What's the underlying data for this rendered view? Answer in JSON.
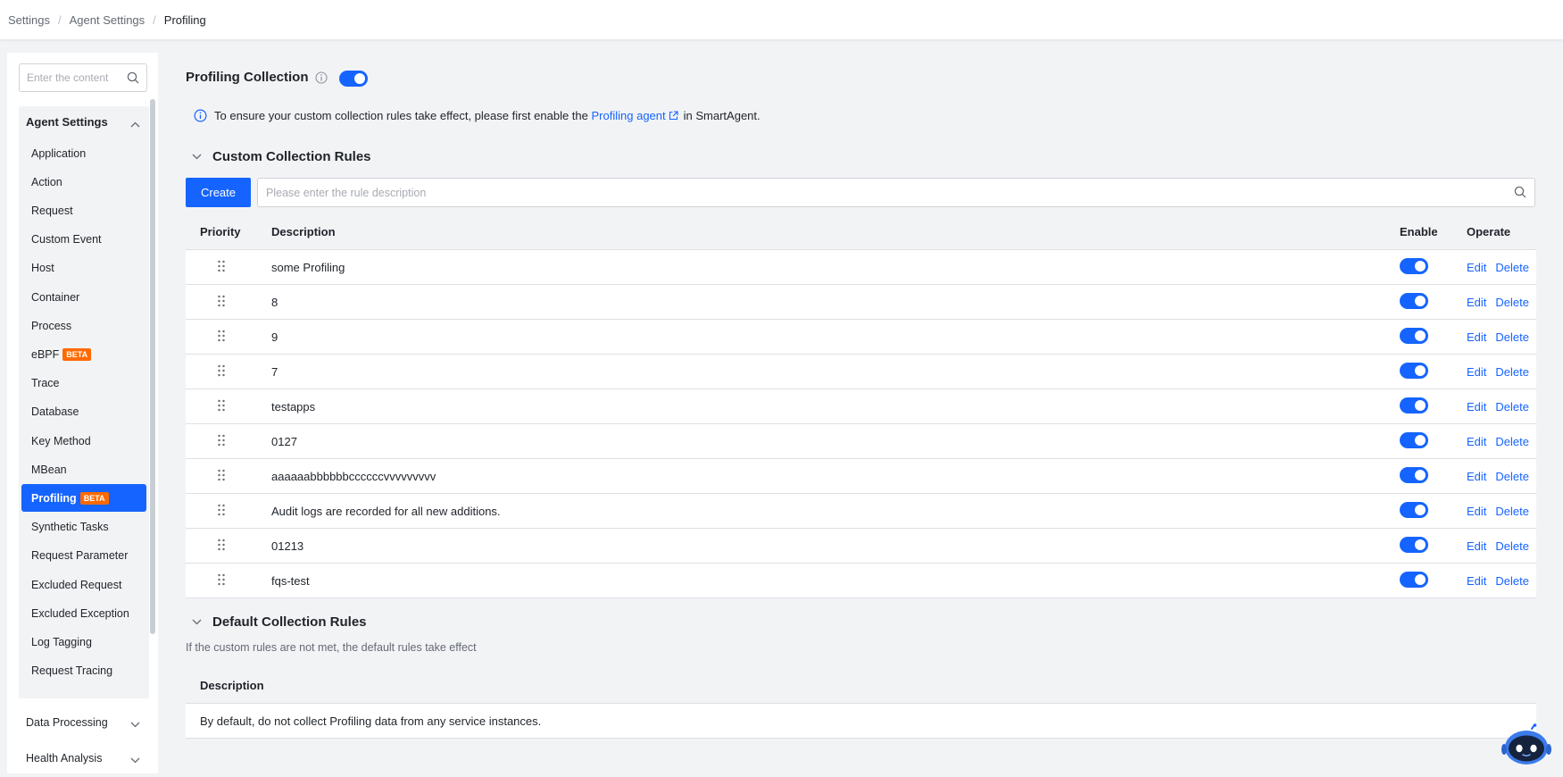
{
  "breadcrumb": [
    "Settings",
    "Agent Settings",
    "Profiling"
  ],
  "sidebar": {
    "search_placeholder": "Enter the content",
    "group_title": "Agent Settings",
    "items": [
      {
        "label": "Application"
      },
      {
        "label": "Action"
      },
      {
        "label": "Request"
      },
      {
        "label": "Custom Event"
      },
      {
        "label": "Host"
      },
      {
        "label": "Container"
      },
      {
        "label": "Process"
      },
      {
        "label": "eBPF",
        "badge": "BETA"
      },
      {
        "label": "Trace"
      },
      {
        "label": "Database"
      },
      {
        "label": "Key Method"
      },
      {
        "label": "MBean"
      },
      {
        "label": "Profiling",
        "badge": "BETA",
        "active": true
      },
      {
        "label": "Synthetic Tasks"
      },
      {
        "label": "Request Parameter"
      },
      {
        "label": "Excluded Request"
      },
      {
        "label": "Excluded Exception"
      },
      {
        "label": "Log Tagging"
      },
      {
        "label": "Request Tracing"
      }
    ],
    "collapsed_groups": [
      {
        "label": "Data Processing"
      },
      {
        "label": "Health Analysis"
      }
    ]
  },
  "main": {
    "title": "Profiling Collection",
    "collection_enabled": true,
    "notice": {
      "prefix": "To ensure your custom collection rules take effect, please first enable the",
      "link": "Profiling agent",
      "suffix": "in SmartAgent."
    },
    "custom": {
      "title": "Custom Collection Rules",
      "create_label": "Create",
      "search_placeholder": "Please enter the rule description",
      "columns": [
        "Priority",
        "Description",
        "Enable",
        "Operate"
      ],
      "edit_label": "Edit",
      "delete_label": "Delete",
      "rows": [
        {
          "description": "some Profiling",
          "enabled": true
        },
        {
          "description": "8",
          "enabled": true
        },
        {
          "description": "9",
          "enabled": true
        },
        {
          "description": "7",
          "enabled": true
        },
        {
          "description": "testapps",
          "enabled": true
        },
        {
          "description": "0127",
          "enabled": true
        },
        {
          "description": "aaaaaabbbbbbccccccvvvvvvvvv",
          "enabled": true
        },
        {
          "description": "Audit logs are recorded for all new additions.",
          "enabled": true
        },
        {
          "description": "01213",
          "enabled": true
        },
        {
          "description": "fqs-test",
          "enabled": true
        }
      ]
    },
    "default": {
      "title": "Default Collection Rules",
      "hint": "If the custom rules are not met, the default rules take effect",
      "column": "Description",
      "row": "By default, do not collect Profiling data from any service instances."
    }
  },
  "colors": {
    "accent": "#1664ff",
    "beta": "#ff6a00",
    "background": "#f2f3f5"
  }
}
